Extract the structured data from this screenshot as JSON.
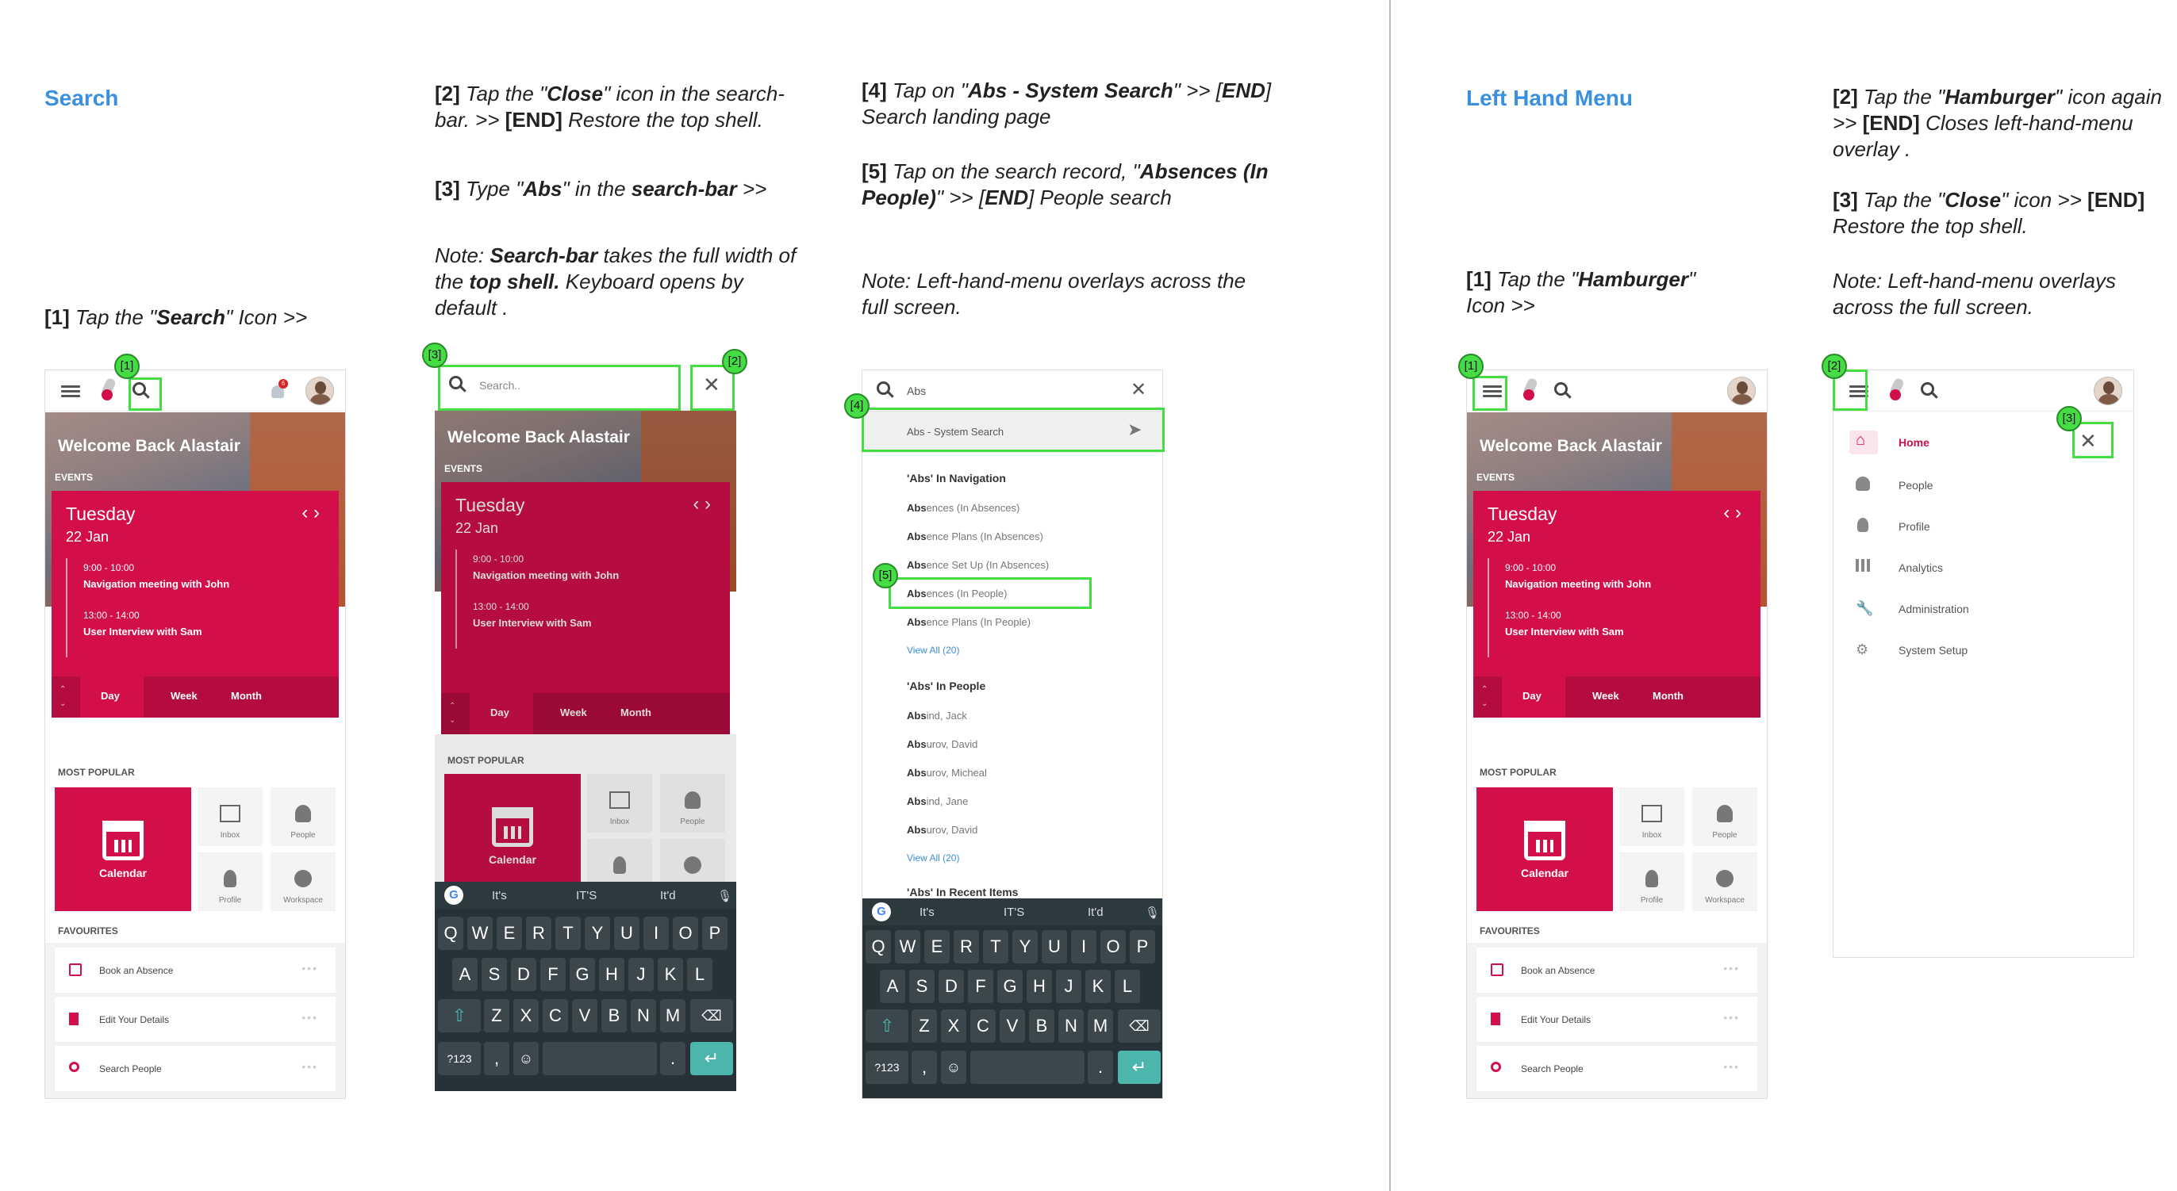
{
  "sections": {
    "search": {
      "title": "Search"
    },
    "left_menu": {
      "title": "Left Hand Menu"
    }
  },
  "notes": {
    "s1_step1": {
      "num": "[1]",
      "pre": " Tap the \"",
      "bold": "Search",
      "post": "\" Icon >>"
    },
    "s2_step2": {
      "num": "[2]",
      "pre": " Tap the \"",
      "bold": "Close",
      "mid": "\" icon in the search-bar.  >> ",
      "end": "[END]",
      "post": " Restore the top shell."
    },
    "s2_step3": {
      "num": "[3]",
      "pre": " Type \"",
      "bold": "Abs",
      "mid": "\" in the ",
      "bold2": "search-bar",
      "post": " >>"
    },
    "s2_note": {
      "pre": "Note: ",
      "bold": "Search-bar",
      "mid": " takes the full width of the ",
      "bold2": "top shell.",
      "post": " Keyboard opens by default ."
    },
    "s3_step4": {
      "num": "[4]",
      "pre": " Tap on \"",
      "bold": "Abs - System Search",
      "mid": "\" >> [",
      "end": "END",
      "post": "] Search landing page"
    },
    "s3_step5": {
      "num": "[5]",
      "pre": " Tap on the search record, \"",
      "bold": "Absences (In People)",
      "mid": "\"  >> [",
      "end": "END",
      "post": "] People search"
    },
    "s3_note": {
      "text": "Note: Left-hand-menu overlays across the full screen."
    },
    "m1_step1": {
      "num": "[1]",
      "pre": " Tap the \"",
      "bold": "Hamburger",
      "post": "\" Icon >>"
    },
    "m2_step2": {
      "num": "[2]",
      "pre": " Tap the \"",
      "bold": "Hamburger",
      "mid": "\" icon again >> ",
      "end": "[END]",
      "post": " Closes left-hand-menu overlay ."
    },
    "m2_step3": {
      "num": "[3]",
      "pre": " Tap the \"",
      "bold": "Close",
      "mid": "\" icon  >> ",
      "end": "[END]",
      "post": " Restore the top shell."
    },
    "m2_note": {
      "text": "Note: Left-hand-menu overlays across the full screen."
    }
  },
  "home": {
    "welcome": "Welcome Back Alastair",
    "events_label": "EVENTS",
    "day": "Tuesday",
    "date": "22 Jan",
    "nav_arrows": "‹  ›",
    "event1_time": "9:00 - 10:00",
    "event1_title": "Navigation meeting with John",
    "event2_time": "13:00 - 14:00",
    "event2_title": "User Interview with Sam",
    "tabs": [
      "Day",
      "Week",
      "Month"
    ],
    "most_popular": "MOST POPULAR",
    "tiles": {
      "calendar": "Calendar",
      "inbox": "Inbox",
      "people": "People",
      "profile": "Profile",
      "workspace": "Workspace"
    },
    "favourites": "FAVOURITES",
    "fav_items": [
      "Book an Absence",
      "Edit Your Details",
      "Search People"
    ],
    "dots": "•••",
    "notification_count": "6"
  },
  "search_screen": {
    "placeholder": "Search..",
    "query": "Abs",
    "system_search": "Abs - System Search",
    "nav_head": "'Abs' In Navigation",
    "nav_results": [
      {
        "match": "Abs",
        "rest": "ences (In Absences)"
      },
      {
        "match": "Abs",
        "rest": "ence Plans (In Absences)"
      },
      {
        "match": "Abs",
        "rest": "ence Set Up (In Absences)"
      },
      {
        "match": "Abs",
        "rest": "ences (In People)"
      },
      {
        "match": "Abs",
        "rest": "ence Plans (In People)"
      }
    ],
    "view_all_1": "View All (20)",
    "people_head": "'Abs' In People",
    "people_results": [
      {
        "match": "Abs",
        "rest": "ind, Jack"
      },
      {
        "match": "Abs",
        "rest": "urov, David"
      },
      {
        "match": "Abs",
        "rest": "urov, Micheal"
      },
      {
        "match": "Abs",
        "rest": "ind, Jane"
      },
      {
        "match": "Abs",
        "rest": "urov, David"
      }
    ],
    "view_all_2": "View All (20)",
    "recent_head": "'Abs' In Recent Items"
  },
  "keyboard": {
    "suggestions": [
      "It's",
      "IT'S",
      "It'd"
    ],
    "row1": [
      "Q",
      "W",
      "E",
      "R",
      "T",
      "Y",
      "U",
      "I",
      "O",
      "P"
    ],
    "row1_nums": [
      "1",
      "2",
      "3",
      "4",
      "5",
      "6",
      "7",
      "8",
      "9",
      "0"
    ],
    "row2": [
      "A",
      "S",
      "D",
      "F",
      "G",
      "H",
      "J",
      "K",
      "L"
    ],
    "row3": [
      "Z",
      "X",
      "C",
      "V",
      "B",
      "N",
      "M"
    ],
    "sym": "?123",
    "comma": ",",
    "period": "."
  },
  "menu": {
    "items": [
      "Home",
      "People",
      "Profile",
      "Analytics",
      "Administration",
      "System Setup"
    ],
    "active_color": "#d20f49"
  },
  "badges": {
    "b1": "[1]",
    "b2": "[2]",
    "b3": "[3]",
    "b4": "[4]",
    "b5": "[5]"
  },
  "colors": {
    "accent": "#d20f49",
    "title_blue": "#3a8fdf",
    "highlight": "#44dd44"
  }
}
